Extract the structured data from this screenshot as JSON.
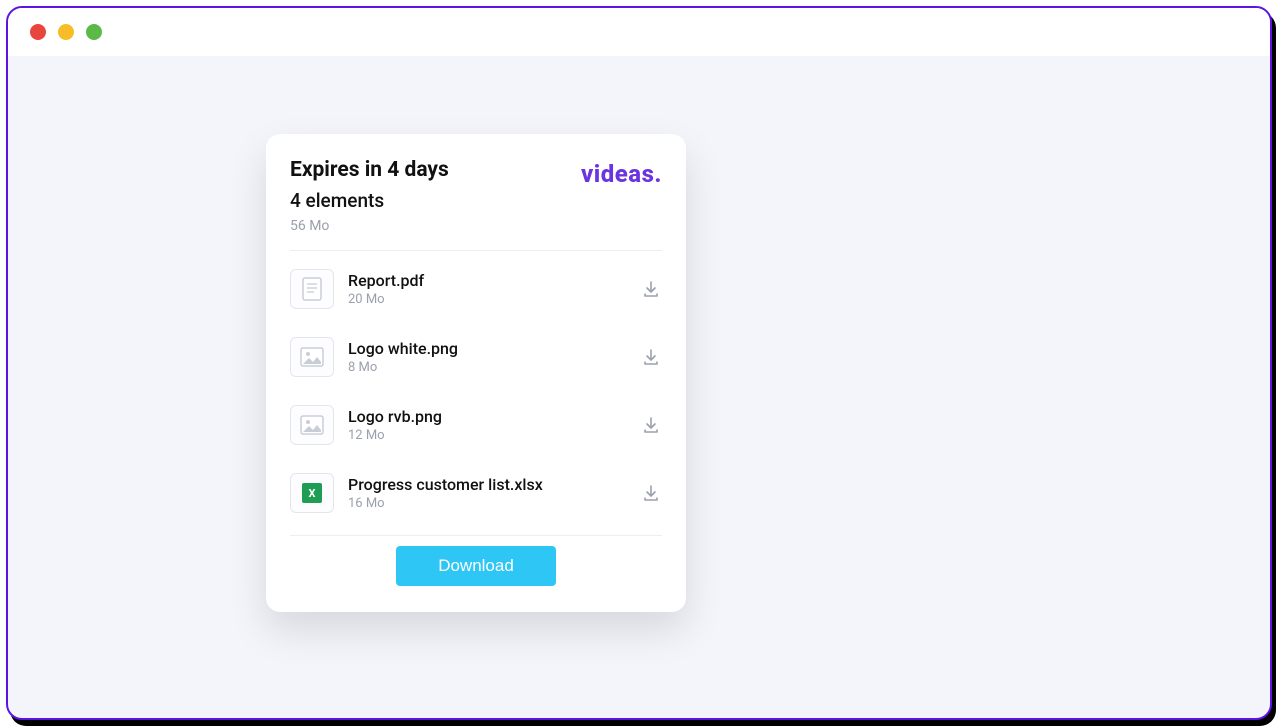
{
  "brand": "videas.",
  "header": {
    "expires": "Expires in 4 days",
    "elements": "4 elements",
    "total_size": "56 Mo"
  },
  "files": [
    {
      "name": "Report.pdf",
      "size": "20 Mo",
      "type": "document"
    },
    {
      "name": "Logo white.png",
      "size": "8 Mo",
      "type": "image"
    },
    {
      "name": "Logo rvb.png",
      "size": "12 Mo",
      "type": "image"
    },
    {
      "name": "Progress customer list.xlsx",
      "size": "16 Mo",
      "type": "spreadsheet"
    }
  ],
  "download_label": "Download"
}
